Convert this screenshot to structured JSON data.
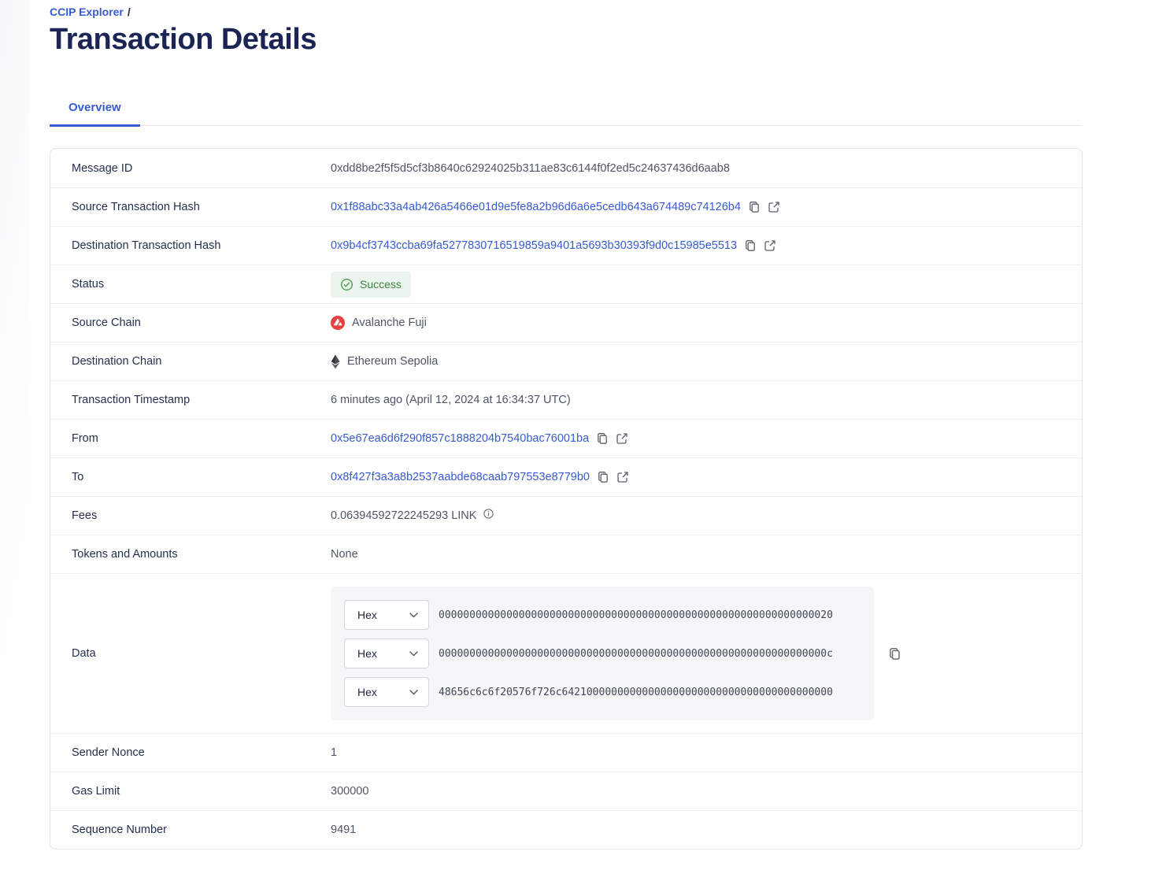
{
  "breadcrumb": {
    "link_label": "CCIP Explorer",
    "separator": "/"
  },
  "header": {
    "title": "Transaction Details"
  },
  "tabs": {
    "overview_label": "Overview"
  },
  "colors": {
    "accent_blue": "#375bd2",
    "title_navy": "#1a2455",
    "success_green": "#3e8444",
    "success_bg": "#ecf5ed",
    "avalanche_red": "#e84142"
  },
  "details": {
    "message_id": {
      "label": "Message ID",
      "value": "0xdd8be2f5f5d5cf3b8640c62924025b311ae83c6144f0f2ed5c24637436d6aab8"
    },
    "source_tx_hash": {
      "label": "Source Transaction Hash",
      "value": "0x1f88abc33a4ab426a5466e01d9e5fe8a2b96d6a6e5cedb643a674489c74126b4"
    },
    "dest_tx_hash": {
      "label": "Destination Transaction Hash",
      "value": "0x9b4cf3743ccba69fa5277830716519859a9401a5693b30393f9d0c15985e5513"
    },
    "status": {
      "label": "Status",
      "value": "Success"
    },
    "source_chain": {
      "label": "Source Chain",
      "value": "Avalanche Fuji"
    },
    "dest_chain": {
      "label": "Destination Chain",
      "value": "Ethereum Sepolia"
    },
    "timestamp": {
      "label": "Transaction Timestamp",
      "value": "6 minutes ago (April 12, 2024 at 16:34:37 UTC)"
    },
    "from": {
      "label": "From",
      "value": "0x5e67ea6d6f290f857c1888204b7540bac76001ba"
    },
    "to": {
      "label": "To",
      "value": "0x8f427f3a3a8b2537aabde68caab797553e8779b0"
    },
    "fees": {
      "label": "Fees",
      "value": "0.06394592722245293 LINK"
    },
    "tokens": {
      "label": "Tokens and Amounts",
      "value": "None"
    },
    "data": {
      "label": "Data",
      "lines": [
        {
          "format": "Hex",
          "value": "0000000000000000000000000000000000000000000000000000000000000020"
        },
        {
          "format": "Hex",
          "value": "000000000000000000000000000000000000000000000000000000000000000c"
        },
        {
          "format": "Hex",
          "value": "48656c6c6f20576f726c64210000000000000000000000000000000000000000"
        }
      ]
    },
    "sender_nonce": {
      "label": "Sender Nonce",
      "value": "1"
    },
    "gas_limit": {
      "label": "Gas Limit",
      "value": "300000"
    },
    "sequence_number": {
      "label": "Sequence Number",
      "value": "9491"
    }
  }
}
